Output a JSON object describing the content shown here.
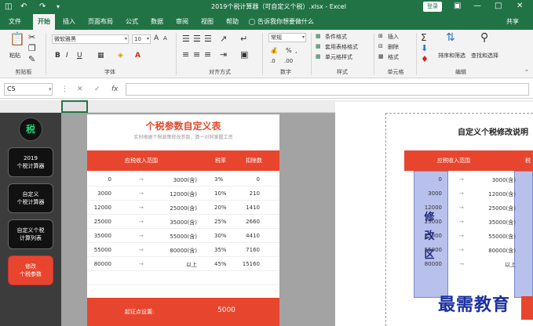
{
  "window": {
    "title": "2019个税计算器（可自定义个税）.xlsx - Excel",
    "signin": "登录"
  },
  "quick_access": {
    "save_icon": "floppy-icon",
    "undo_icon": "undo-icon",
    "redo_icon": "redo-icon"
  },
  "tabs": [
    {
      "label": "文件"
    },
    {
      "label": "开始"
    },
    {
      "label": "插入"
    },
    {
      "label": "页面布局"
    },
    {
      "label": "公式"
    },
    {
      "label": "数据"
    },
    {
      "label": "审阅"
    },
    {
      "label": "视图"
    },
    {
      "label": "帮助"
    }
  ],
  "tell_me": "告诉我你想要做什么",
  "share": "共享",
  "ribbon": {
    "paste_label": "粘贴",
    "clipboard_label": "剪贴板",
    "font_name": "微软雅黑",
    "font_size": "10",
    "font_label": "字体",
    "align_label": "对齐方式",
    "number_format": "常规",
    "number_label": "数字",
    "cond_format": "条件格式",
    "table_format": "套用表格格式",
    "cell_style": "单元格样式",
    "styles_label": "样式",
    "insert": "插入",
    "delete": "删除",
    "format": "格式",
    "cells_label": "单元格",
    "sort_filter": "排序和筛选",
    "find_select": "查找和选择",
    "edit_label": "编辑",
    "bold": "B",
    "italic": "I",
    "underline": "U",
    "grow_font": "A",
    "shrink_font": "A",
    "fx": "fx",
    "cancel": "✕",
    "enter": "✓"
  },
  "name_box": "C5",
  "sidebar": {
    "logo": "税",
    "buttons": [
      {
        "label": "2019\n个税计算器"
      },
      {
        "label": "自定义\n个税计算器"
      },
      {
        "label": "自定义个税\n计算列表"
      },
      {
        "label": "修改\n个税参数"
      }
    ]
  },
  "card1": {
    "title": "个税参数自定义表",
    "subtitle": "实时根据个税政策修改参数，算一对同掌握工资",
    "headers": {
      "range": "应税收入范围",
      "rate": "税率",
      "deduction": "扣除数"
    },
    "rows": [
      {
        "low": "0",
        "high": "3000(含)",
        "rate": "3%",
        "ded": "0"
      },
      {
        "low": "3000",
        "high": "12000(含)",
        "rate": "10%",
        "ded": "210"
      },
      {
        "low": "12000",
        "high": "25000(含)",
        "rate": "20%",
        "ded": "1410"
      },
      {
        "low": "25000",
        "high": "35000(含)",
        "rate": "25%",
        "ded": "2660"
      },
      {
        "low": "35000",
        "high": "55000(含)",
        "rate": "30%",
        "ded": "4410"
      },
      {
        "low": "55000",
        "high": "80000(含)",
        "rate": "35%",
        "ded": "7160"
      },
      {
        "low": "80000",
        "high": "以上",
        "rate": "45%",
        "ded": "15160"
      }
    ],
    "arrow": "→",
    "threshold_label": "起征点设置:",
    "threshold_value": "5000"
  },
  "card2": {
    "title": "自定义个税修改说明",
    "header_range": "应税收入范围",
    "header_rate": "税",
    "modify": "修改区",
    "rows": [
      {
        "low": "0",
        "high": "3000(含)"
      },
      {
        "low": "3000",
        "high": "12000(含)"
      },
      {
        "low": "12000",
        "high": "25000(含)"
      },
      {
        "low": "25000",
        "high": "35000(含)"
      },
      {
        "low": "35000",
        "high": "55000(含)"
      },
      {
        "low": "55000",
        "high": "80000(含)"
      },
      {
        "low": "80000",
        "high": "以上"
      }
    ],
    "arrow": "→"
  },
  "watermark": "最需教育"
}
